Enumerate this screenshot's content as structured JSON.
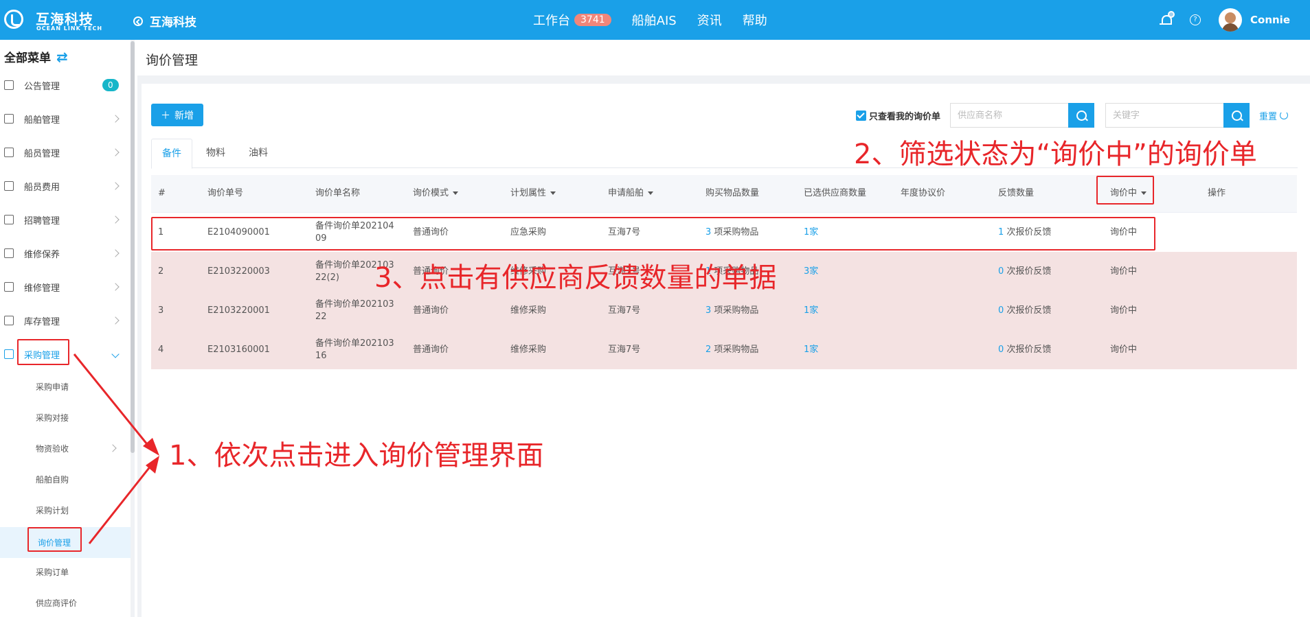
{
  "topbar": {
    "logo_cn": "互海科技",
    "logo_en": "OCEAN LINK TECH",
    "back_label": "互海科技",
    "nav": [
      {
        "label": "工作台",
        "badge": "3741"
      },
      {
        "label": "船舶AIS"
      },
      {
        "label": "资讯"
      },
      {
        "label": "帮助"
      }
    ],
    "help_glyph": "?",
    "username": "Connie"
  },
  "sidebar": {
    "header": "全部菜单",
    "header_icon": "⇄",
    "items": [
      {
        "label": "公告管理",
        "badge": "0",
        "icon": "book-icon"
      },
      {
        "label": "船舶管理",
        "icon": "anchor-icon"
      },
      {
        "label": "船员管理",
        "icon": "person-icon"
      },
      {
        "label": "船员费用",
        "icon": "wallet-icon"
      },
      {
        "label": "招聘管理",
        "icon": "recruit-icon"
      },
      {
        "label": "维修保养",
        "icon": "hammer-icon"
      },
      {
        "label": "维修管理",
        "icon": "wrench-icon"
      },
      {
        "label": "库存管理",
        "icon": "warehouse-icon"
      },
      {
        "label": "采购管理",
        "icon": "cart-icon"
      }
    ],
    "subitems": [
      {
        "label": "采购申请"
      },
      {
        "label": "采购对接"
      },
      {
        "label": "物资验收"
      },
      {
        "label": "船舶自购"
      },
      {
        "label": "采购计划"
      },
      {
        "label": "询价管理"
      },
      {
        "label": "采购订单"
      },
      {
        "label": "供应商评价"
      }
    ]
  },
  "main": {
    "title": "询价管理",
    "add_button": "新增",
    "only_mine_label": "只查看我的询价单",
    "supplier_placeholder": "供应商名称",
    "keyword_placeholder": "关键字",
    "reset_label": "重置",
    "tabs": [
      "备件",
      "物料",
      "油料"
    ],
    "columns": [
      "#",
      "询价单号",
      "询价单名称",
      "询价模式",
      "计划属性",
      "申请船舶",
      "购买物品数量",
      "已选供应商数量",
      "年度协议价",
      "反馈数量",
      "询价中",
      "操作"
    ],
    "rows": [
      {
        "idx": "1",
        "no": "E2104090001",
        "name_l1": "备件询价单202104",
        "name_l2": "09",
        "mode": "普通询价",
        "plan": "应急采购",
        "ship": "互海7号",
        "qty_num": "3",
        "qty_text": "项采购物品",
        "suppliers": "1家",
        "annual": "",
        "fb_num": "1",
        "fb_text": "次报价反馈",
        "status": "询价中",
        "op": ""
      },
      {
        "idx": "2",
        "no": "E2103220003",
        "name_l1": "备件询价单202103",
        "name_l2": "22(2)",
        "mode": "普通询价",
        "plan": "维修采购",
        "ship": "互海7号",
        "qty_num": "1",
        "qty_text": "项采购物品",
        "suppliers": "3家",
        "annual": "",
        "fb_num": "0",
        "fb_text": "次报价反馈",
        "status": "询价中",
        "op": ""
      },
      {
        "idx": "3",
        "no": "E2103220001",
        "name_l1": "备件询价单202103",
        "name_l2": "22",
        "mode": "普通询价",
        "plan": "维修采购",
        "ship": "互海7号",
        "qty_num": "3",
        "qty_text": "项采购物品",
        "suppliers": "1家",
        "annual": "",
        "fb_num": "0",
        "fb_text": "次报价反馈",
        "status": "询价中",
        "op": ""
      },
      {
        "idx": "4",
        "no": "E2103160001",
        "name_l1": "备件询价单202103",
        "name_l2": "16",
        "mode": "普通询价",
        "plan": "维修采购",
        "ship": "互海7号",
        "qty_num": "2",
        "qty_text": "项采购物品",
        "suppliers": "1家",
        "annual": "",
        "fb_num": "0",
        "fb_text": "次报价反馈",
        "status": "询价中",
        "op": ""
      }
    ]
  },
  "annotations": {
    "step1": "1、依次点击进入询价管理界面",
    "step2": "2、筛选状态为“询价中”的询价单",
    "step3": "3、点击有供应商反馈数量的单据"
  },
  "colors": {
    "brand": "#1aa0e8",
    "annotation_red": "#e8262a",
    "row_highlight": "#f4e2e2",
    "badge_orange": "#f2867a",
    "badge_teal": "#17b6c9"
  }
}
